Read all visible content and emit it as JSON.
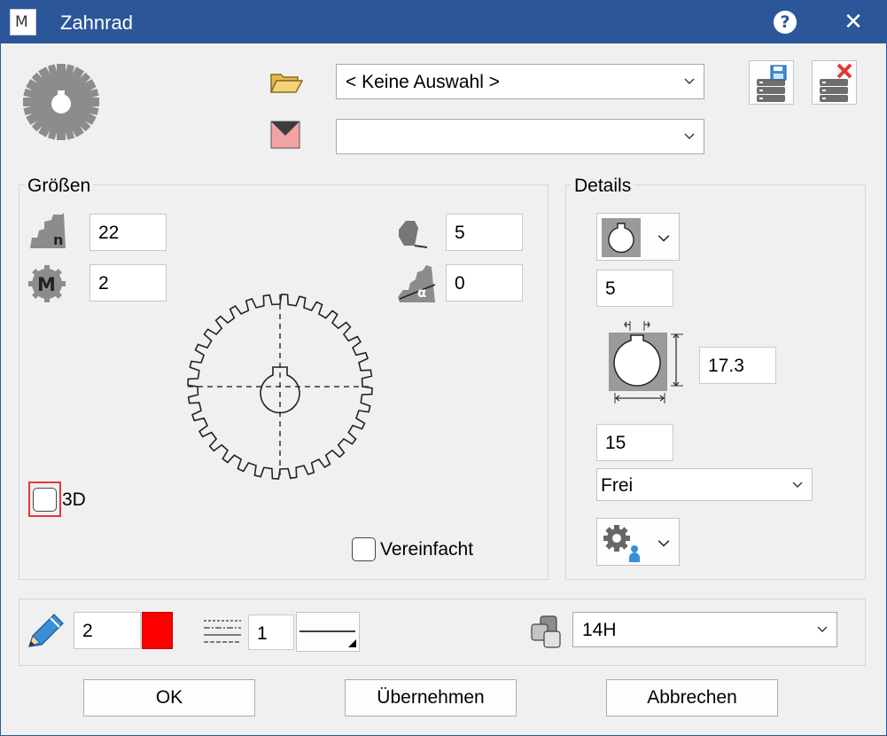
{
  "window": {
    "title": "Zahnrad",
    "app_icon": "M",
    "help": "?",
    "close": "✕"
  },
  "selectors": {
    "library_value": "< Keine Auswahl >",
    "layer_value": ""
  },
  "groessen": {
    "label": "Größen",
    "teeth": "22",
    "module": "2",
    "bore": "5",
    "angle": "0",
    "check_3d": "3D",
    "check_simplified": "Vereinfacht"
  },
  "details": {
    "label": "Details",
    "bore_diameter": "5",
    "keyway_height": "17.3",
    "hub_length": "15",
    "fit_mode": "Frei"
  },
  "bottom": {
    "pen_width": "2",
    "pen_color": "#ff0000",
    "line_scale": "1",
    "tolerance": "14H"
  },
  "buttons": {
    "ok": "OK",
    "apply": "Übernehmen",
    "cancel": "Abbrechen"
  },
  "colors": {
    "titlebar": "#2b579a",
    "accent_red": "#ff0000",
    "highlight": "#e53935",
    "icon_blue": "#3a8fd6"
  }
}
